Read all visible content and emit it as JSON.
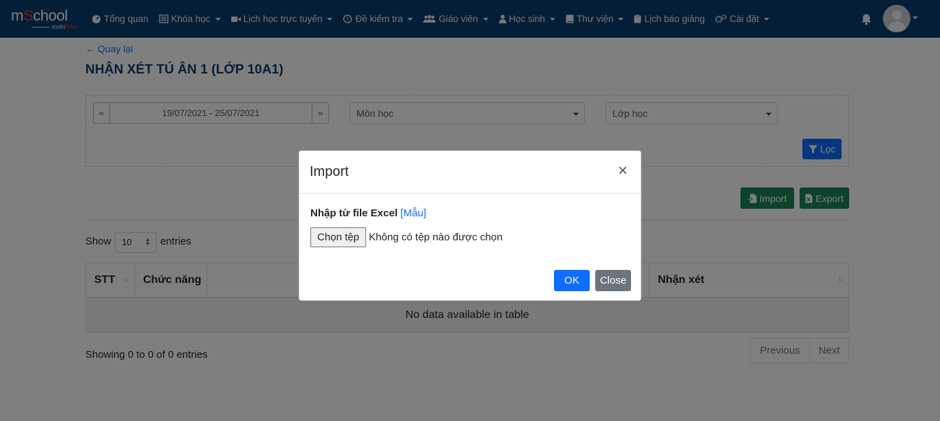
{
  "brand": {
    "logo_main_1": "m",
    "logo_main_red": "S",
    "logo_main_2": "chool",
    "logo_sub_1": "mobi",
    "logo_sub_red": "fone"
  },
  "nav": [
    {
      "label": "Tổng quan",
      "icon": "dashboard-icon",
      "dropdown": false
    },
    {
      "label": "Khóa học",
      "icon": "list-icon",
      "dropdown": true
    },
    {
      "label": "Lịch học trực tuyến",
      "icon": "video-icon",
      "dropdown": true
    },
    {
      "label": "Đề kiểm tra",
      "icon": "question-circle-icon",
      "dropdown": true
    },
    {
      "label": "Giáo viên",
      "icon": "users-icon",
      "dropdown": true
    },
    {
      "label": "Học sinh",
      "icon": "user-icon",
      "dropdown": true
    },
    {
      "label": "Thư viện",
      "icon": "book-icon",
      "dropdown": true
    },
    {
      "label": "Lịch báo giảng",
      "icon": "clipboard-icon",
      "dropdown": false
    },
    {
      "label": "Cài đặt",
      "icon": "gears-icon",
      "dropdown": true
    }
  ],
  "page": {
    "back": "← Quay lại",
    "title": "NHẬN XÉT TÚ ÂN 1 (LỚP 10A1)"
  },
  "filters": {
    "date_prev": "«",
    "date_range": "19/07/2021 - 25/07/2021",
    "date_next": "»",
    "subject_placeholder": "Môn học",
    "class_placeholder": "Lớp học",
    "filter_button": "Lọc"
  },
  "actions": {
    "import": "Import",
    "export": "Export"
  },
  "table": {
    "show": "Show",
    "entries_value": "10",
    "entries": "entries",
    "columns": [
      "STT",
      "Chức năng",
      "Nhận xét"
    ],
    "empty": "No data available in table",
    "info": "Showing 0 to 0 of 0 entries",
    "prev": "Previous",
    "next": "Next"
  },
  "modal": {
    "title": "Import",
    "close_symbol": "×",
    "label_bold": "Nhập từ file Excel",
    "label_link": "[Mẫu]",
    "file_button": "Chọn tệp",
    "file_status": "Không có tệp nào được chọn",
    "ok": "OK",
    "close": "Close"
  },
  "colors": {
    "navbar": "#0b3c6e",
    "primary": "#0d6efd",
    "success": "#198754",
    "secondary": "#6c757d"
  }
}
